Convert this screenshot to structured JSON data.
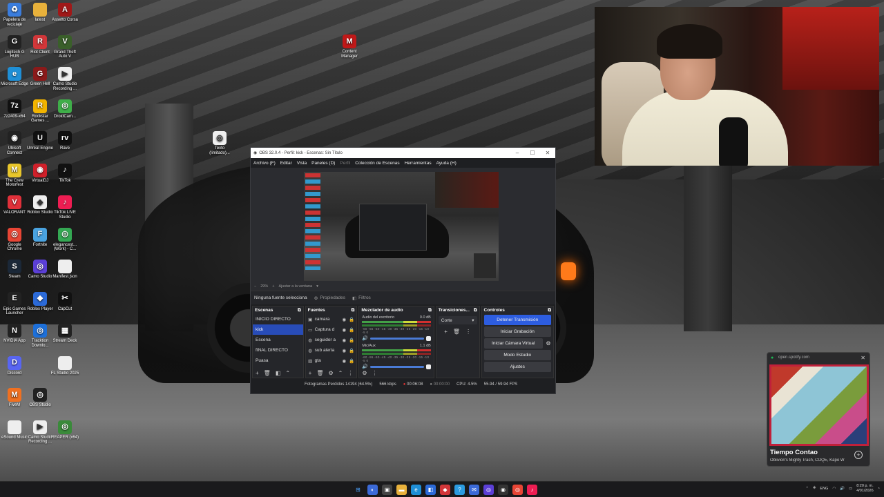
{
  "desktop": {
    "icons": [
      {
        "label": "Papelera de reciclaje",
        "icon": "recycle-bin-icon",
        "color": "#3b7ddd",
        "glyph": "♻"
      },
      {
        "label": "latest",
        "icon": "folder-icon",
        "color": "#e8b13b",
        "glyph": ""
      },
      {
        "label": "Assetto Corsa",
        "icon": "assetto-corsa-icon",
        "color": "#a01818",
        "glyph": "A"
      },
      {
        "label": "Logitech G HUB",
        "icon": "logitech-icon",
        "color": "#222",
        "glyph": "G"
      },
      {
        "label": "Riot Client",
        "icon": "riot-icon",
        "color": "#d13639",
        "glyph": "R"
      },
      {
        "label": "Grand Theft Auto V",
        "icon": "gta-icon",
        "color": "#3a5f2a",
        "glyph": "V"
      },
      {
        "label": "Microsoft Edge",
        "icon": "edge-icon",
        "color": "#1f8fd6",
        "glyph": "e"
      },
      {
        "label": "Green Hell",
        "icon": "green-hell-icon",
        "color": "#8a1a1a",
        "glyph": "G"
      },
      {
        "label": "Camo Studio Recording ...",
        "icon": "file-icon",
        "color": "#eee",
        "glyph": "▶"
      },
      {
        "label": "7z2409-x64",
        "icon": "7zip-icon",
        "color": "#111",
        "glyph": "7z"
      },
      {
        "label": "Rockstar Games ...",
        "icon": "rockstar-icon",
        "color": "#f2b400",
        "glyph": "R"
      },
      {
        "label": "DroidCam...",
        "icon": "droidcam-icon",
        "color": "#3fae49",
        "glyph": "◎"
      },
      {
        "label": "Ubisoft Connect",
        "icon": "ubisoft-icon",
        "color": "#222",
        "glyph": "◉"
      },
      {
        "label": "Unreal Engine",
        "icon": "unreal-icon",
        "color": "#111",
        "glyph": "U"
      },
      {
        "label": "Rave",
        "icon": "rave-icon",
        "color": "#111",
        "glyph": "rv"
      },
      {
        "label": "The Crew Motorfest",
        "icon": "the-crew-icon",
        "color": "#e8c62b",
        "glyph": "M"
      },
      {
        "label": "VirtualDJ",
        "icon": "virtualdj-icon",
        "color": "#d0202a",
        "glyph": "◉"
      },
      {
        "label": "TikTok",
        "icon": "tiktok-icon",
        "color": "#111",
        "glyph": "♪"
      },
      {
        "label": "VALORANT",
        "icon": "valorant-icon",
        "color": "#e0303a",
        "glyph": "V"
      },
      {
        "label": "Roblox Studio",
        "icon": "roblox-studio-icon",
        "color": "#eee",
        "glyph": "◆"
      },
      {
        "label": "TikTok LIVE Studio",
        "icon": "tiktok-live-icon",
        "color": "#ee1d52",
        "glyph": "♪"
      },
      {
        "label": "Google Chrome",
        "icon": "chrome-icon",
        "color": "#e84535",
        "glyph": "◎"
      },
      {
        "label": "Fortnite",
        "icon": "fortnite-icon",
        "color": "#4aa3e0",
        "glyph": "F"
      },
      {
        "label": "elegancest... (Work) - C...",
        "icon": "chrome-profile-icon",
        "color": "#34a853",
        "glyph": "◎"
      },
      {
        "label": "Steam",
        "icon": "steam-icon",
        "color": "#1b2838",
        "glyph": "S"
      },
      {
        "label": "Camo Studio",
        "icon": "camo-icon",
        "color": "#5b3fd6",
        "glyph": "◎"
      },
      {
        "label": "Manifest.json",
        "icon": "file-icon",
        "color": "#eee",
        "glyph": ""
      },
      {
        "label": "Epic Games Launcher",
        "icon": "epic-icon",
        "color": "#222",
        "glyph": "E"
      },
      {
        "label": "Roblox Player",
        "icon": "roblox-icon",
        "color": "#2b6ad8",
        "glyph": "◆"
      },
      {
        "label": "CapCut",
        "icon": "capcut-icon",
        "color": "#111",
        "glyph": "✂"
      },
      {
        "label": "NVIDIA App",
        "icon": "nvidia-icon",
        "color": "#222",
        "glyph": "N"
      },
      {
        "label": "Tracktion Downlo...",
        "icon": "tracktion-icon",
        "color": "#1d6fd8",
        "glyph": "◎"
      },
      {
        "label": "Stream Deck",
        "icon": "stream-deck-icon",
        "color": "#222",
        "glyph": "▦"
      },
      {
        "label": "Discord",
        "icon": "discord-icon",
        "color": "#5865f2",
        "glyph": "D"
      },
      {
        "label": "",
        "icon": "",
        "color": "",
        "glyph": ""
      },
      {
        "label": "FL Studio 2025",
        "icon": "file-icon",
        "color": "#eee",
        "glyph": ""
      },
      {
        "label": "FiveM",
        "icon": "fivem-icon",
        "color": "#f07020",
        "glyph": "M"
      },
      {
        "label": "OBS Studio",
        "icon": "obs-icon",
        "color": "#222",
        "glyph": "◎"
      },
      {
        "label": "",
        "icon": "",
        "color": "",
        "glyph": ""
      },
      {
        "label": "eSound Music",
        "icon": "file-icon",
        "color": "#eee",
        "glyph": ""
      },
      {
        "label": "Camo Studio Recording ...",
        "icon": "file-icon",
        "color": "#eee",
        "glyph": "▶"
      },
      {
        "label": "REAPER (x64)",
        "icon": "reaper-icon",
        "color": "#3a8a3a",
        "glyph": "◎"
      }
    ],
    "extra": [
      {
        "label": "Content Manager",
        "icon": "content-manager-icon",
        "color": "#c01818",
        "glyph": "M"
      },
      {
        "label": "Texto (limitado)...",
        "icon": "chrome-file-icon",
        "color": "#eee",
        "glyph": "◎"
      }
    ]
  },
  "obs": {
    "title": "OBS 32.0.4 - Perfil: kick - Escenas: Sin Título",
    "menu": [
      "Archivo (F)",
      "Editar",
      "Vista",
      "Paneles (D)",
      "Perfil",
      "Colección de Escenas",
      "Herramientas",
      "Ayuda (H)"
    ],
    "zoom": "29%",
    "fit_label": "Ajustar a la ventana",
    "no_source": "Ninguna fuente selecciona",
    "properties": "Propiedades",
    "filters": "Filtros",
    "scenes_title": "Escenas",
    "scenes": [
      "INICIO DIRECTO",
      "kick",
      "Escena",
      "fINAL DIRECTO",
      "Puasa"
    ],
    "selected_scene": 1,
    "sources_title": "Fuentes",
    "sources": [
      "camara",
      "Captura d",
      "seguidor a",
      "sub alerta",
      "gta"
    ],
    "mixer_title": "Mezclador de audio",
    "mixer": [
      {
        "name": "Audio del escritorio",
        "db": "0.0 dB"
      },
      {
        "name": "Mic/Aux",
        "db": "1.1 dB"
      }
    ],
    "meter_ticks": "-60 -55 -50 -45 -40 -35 -30 -25 -20 -15 -10 -5 0",
    "transitions_title": "Transiciones...",
    "transition": "Corte",
    "controls_title": "Controles",
    "controls": [
      "Detener Transmisión",
      "Iniciar Grabación",
      "Iniciar Cámara Virtual",
      "Modo Estudio",
      "Ajustes"
    ],
    "status": {
      "dropped": "Fotogramas Perdidos 14194 (64.5%)",
      "bitrate": "566 kbps",
      "stream_time": "00:06:08",
      "rec_time": "00:00:00",
      "cpu": "CPU: 4.5%",
      "fps": "55.94 / 59.94 FPS"
    }
  },
  "spotify": {
    "url": "open.spotify.com",
    "song": "Tiempo Contao",
    "artists": "Oblivion's Mighty Trash, COQE, Kapo W"
  },
  "taskbar": {
    "lang": "ENG",
    "time": "8:20 p. m.",
    "date": "4/01/2026"
  }
}
